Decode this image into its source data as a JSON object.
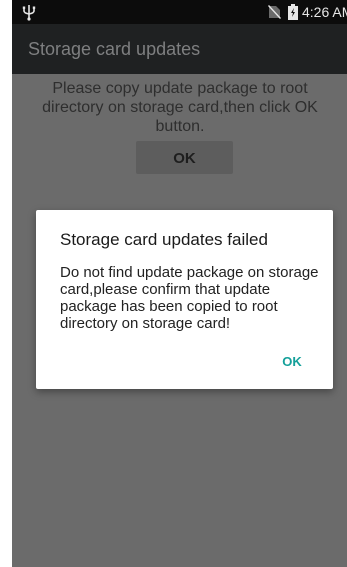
{
  "status_bar": {
    "usb_icon": "usb-icon",
    "no_sim_icon": "no-sim-icon",
    "battery_icon": "battery-icon",
    "time": "4:26 AM"
  },
  "app_bar": {
    "title": "Storage card updates"
  },
  "main": {
    "instruction": "Please copy update package to root directory on storage card,then click OK button.",
    "ok_label": "OK"
  },
  "dialog": {
    "title": "Storage card updates failed",
    "message": "Do not find update package on storage card,please confirm that update package has been copied to root directory on storage card!",
    "ok_label": "OK",
    "accent_color": "#14a09a"
  }
}
